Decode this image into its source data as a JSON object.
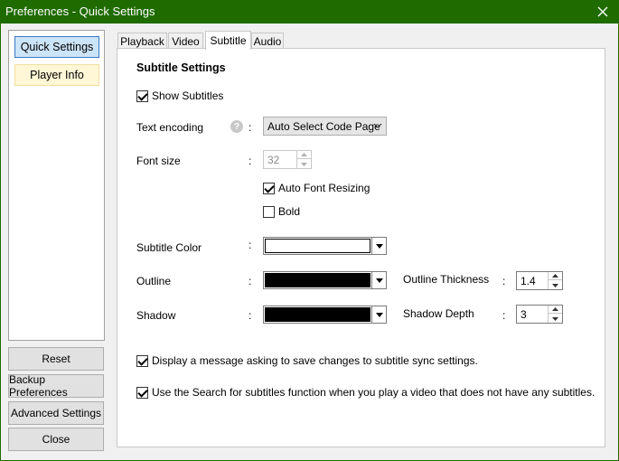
{
  "window": {
    "title": "Preferences - Quick Settings"
  },
  "sidebar": {
    "items": [
      {
        "label": "Quick Settings"
      },
      {
        "label": "Player Info"
      }
    ],
    "buttons": {
      "reset": "Reset",
      "backup": "Backup Preferences",
      "advanced": "Advanced Settings",
      "close": "Close"
    }
  },
  "tabs": [
    {
      "label": "Playback"
    },
    {
      "label": "Video"
    },
    {
      "label": "Subtitle"
    },
    {
      "label": "Audio"
    }
  ],
  "subtitle": {
    "section_title": "Subtitle Settings",
    "show_subtitles": {
      "label": "Show Subtitles",
      "checked": true
    },
    "text_encoding": {
      "label": "Text encoding",
      "colon": ":",
      "value": "Auto Select Code Page",
      "help_icon": "?"
    },
    "font_size": {
      "label": "Font size",
      "colon": ":",
      "value": "32"
    },
    "auto_font_resizing": {
      "label": "Auto Font Resizing",
      "checked": true
    },
    "bold": {
      "label": "Bold",
      "checked": false
    },
    "subtitle_color": {
      "label": "Subtitle Color",
      "colon": ":",
      "color": "#ffffff"
    },
    "outline": {
      "label": "Outline",
      "colon": ":",
      "color": "#000000"
    },
    "outline_thickness": {
      "label": "Outline Thickness",
      "colon": ":",
      "value": "1.4"
    },
    "shadow": {
      "label": "Shadow",
      "colon": ":",
      "color": "#000000"
    },
    "shadow_depth": {
      "label": "Shadow Depth",
      "colon": ":",
      "value": "3"
    },
    "sync_message": {
      "label": "Display a message asking to save changes to subtitle sync settings.",
      "checked": true
    },
    "search_subtitles": {
      "label": "Use the Search for subtitles function when you play a video that does not have any subtitles.",
      "checked": true
    }
  },
  "colors": {
    "titlebar": "#1f6b00",
    "selection": "#cce4f7",
    "accent": "#3a7ac6"
  }
}
